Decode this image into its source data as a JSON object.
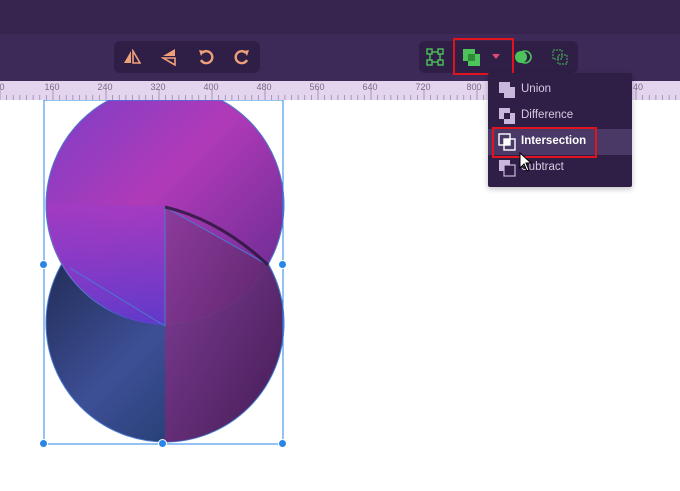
{
  "app": {
    "colors": {
      "titlebar": "#37254f",
      "toolbar": "#3d2a58",
      "group_bg": "#2f1f46",
      "accent_green": "#4cc35b",
      "accent_orange": "#f0a078",
      "highlight_red": "#e0141e",
      "selection_blue": "#2a86e6"
    }
  },
  "toolbar": {
    "transform_group": {
      "flip_horizontal": {
        "icon": "flip-horizontal-icon"
      },
      "flip_vertical": {
        "icon": "flip-vertical-icon"
      },
      "rotate_ccw": {
        "icon": "rotate-ccw-icon"
      },
      "rotate_cw": {
        "icon": "rotate-cw-icon"
      }
    },
    "boolean_group": {
      "path_edit": {
        "icon": "path-edit-icon"
      },
      "boolean_op": {
        "icon": "boolean-intersection-icon"
      },
      "dropdown_toggle": {
        "icon": "chevron-down-icon"
      },
      "mask": {
        "icon": "mask-icon"
      },
      "group": {
        "icon": "group-nodes-icon"
      }
    }
  },
  "ruler": {
    "ticks": [
      "0",
      "160",
      "240",
      "320",
      "400",
      "480",
      "560",
      "640",
      "720",
      "800",
      "40"
    ]
  },
  "boolean_menu": {
    "items": [
      {
        "label": "Union",
        "icon": "union-icon"
      },
      {
        "label": "Difference",
        "icon": "difference-icon"
      },
      {
        "label": "Intersection",
        "icon": "intersection-icon",
        "hovered": true
      },
      {
        "label": "Subtract",
        "icon": "subtract-icon"
      }
    ]
  }
}
